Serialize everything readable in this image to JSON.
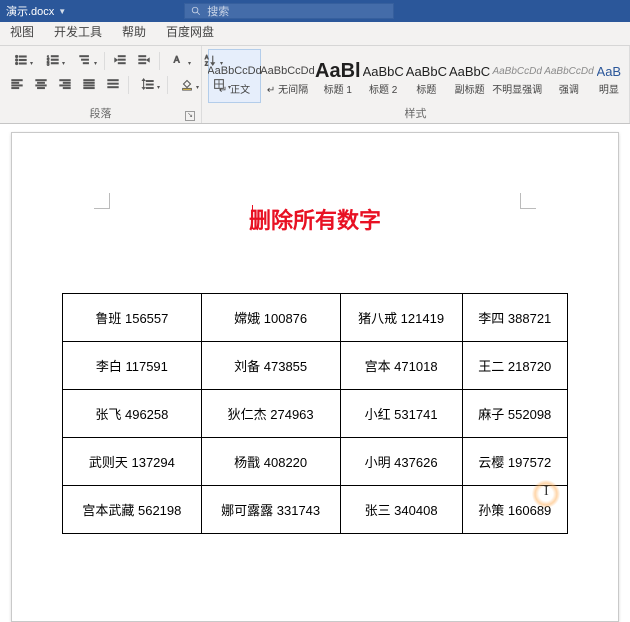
{
  "titlebar": {
    "filename": "演示.docx",
    "search_placeholder": "搜索"
  },
  "tabs": [
    "视图",
    "开发工具",
    "帮助",
    "百度网盘"
  ],
  "ribbon": {
    "paragraph_label": "段落",
    "styles_label": "样式",
    "styles": [
      {
        "sample": "AaBbCcDd",
        "label": "正文",
        "cls": "small",
        "selected": true,
        "arrow": true
      },
      {
        "sample": "AaBbCcDd",
        "label": "无间隔",
        "cls": "small",
        "selected": false,
        "arrow": true
      },
      {
        "sample": "AaBl",
        "label": "标题 1",
        "cls": "big",
        "selected": false,
        "arrow": false
      },
      {
        "sample": "AaBbC",
        "label": "标题 2",
        "cls": "med",
        "selected": false,
        "arrow": false
      },
      {
        "sample": "AaBbC",
        "label": "标题",
        "cls": "med",
        "selected": false,
        "arrow": false
      },
      {
        "sample": "AaBbC",
        "label": "副标题",
        "cls": "med",
        "selected": false,
        "arrow": false
      },
      {
        "sample": "AaBbCcDd",
        "label": "不明显强调",
        "cls": "grey",
        "selected": false,
        "arrow": false
      },
      {
        "sample": "AaBbCcDd",
        "label": "强调",
        "cls": "grey",
        "selected": false,
        "arrow": false
      },
      {
        "sample": "AaB",
        "label": "明显",
        "cls": "med blue",
        "selected": false,
        "arrow": false
      }
    ]
  },
  "document": {
    "title": "删除所有数字",
    "table": [
      [
        "鲁班 156557",
        "嫦娥 100876",
        "猪八戒 121419",
        "李四 388721"
      ],
      [
        "李白 117591",
        "刘备 473855",
        "宫本 471018",
        "王二 218720"
      ],
      [
        "张飞 496258",
        "狄仁杰 274963",
        "小红 531741",
        "麻子 552098"
      ],
      [
        "武则天 137294",
        "杨戬 408220",
        "小明 437626",
        "云樱 197572"
      ],
      [
        "宫本武藏 562198",
        "娜可露露 331743",
        "张三 340408",
        "孙策 160689"
      ]
    ]
  }
}
